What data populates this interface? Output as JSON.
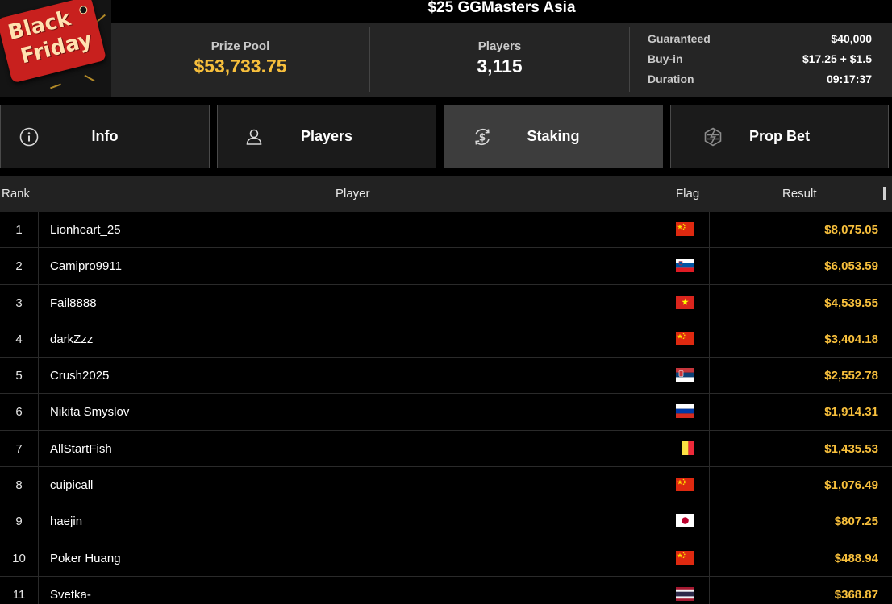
{
  "title": "$25 GGMasters Asia",
  "banner": {
    "line1": "Black",
    "line2": "Friday"
  },
  "stats": {
    "prize_pool_label": "Prize Pool",
    "prize_pool_value": "$53,733.75",
    "players_label": "Players",
    "players_value": "3,115",
    "guaranteed_label": "Guaranteed",
    "guaranteed_value": "$40,000",
    "buyin_label": "Buy-in",
    "buyin_value": "$17.25 + $1.5",
    "duration_label": "Duration",
    "duration_value": "09:17:37"
  },
  "tabs": [
    {
      "label": "Info",
      "icon": "info-icon",
      "active": false
    },
    {
      "label": "Players",
      "icon": "user-icon",
      "active": false
    },
    {
      "label": "Staking",
      "icon": "dollar-cycle-icon",
      "active": true
    },
    {
      "label": "Prop Bet",
      "icon": "prop-bet-icon",
      "active": false
    }
  ],
  "table": {
    "headers": {
      "rank": "Rank",
      "player": "Player",
      "flag": "Flag",
      "result": "Result"
    },
    "rows": [
      {
        "rank": "1",
        "player": "Lionheart_25",
        "flag": "cn",
        "result": "$8,075.05"
      },
      {
        "rank": "2",
        "player": "Camipro9911",
        "flag": "si",
        "result": "$6,053.59"
      },
      {
        "rank": "3",
        "player": "Fail8888",
        "flag": "vn",
        "result": "$4,539.55"
      },
      {
        "rank": "4",
        "player": "darkZzz",
        "flag": "cn",
        "result": "$3,404.18"
      },
      {
        "rank": "5",
        "player": "Crush2025",
        "flag": "rs",
        "result": "$2,552.78"
      },
      {
        "rank": "6",
        "player": "Nikita Smyslov",
        "flag": "ru",
        "result": "$1,914.31"
      },
      {
        "rank": "7",
        "player": "AllStartFish",
        "flag": "be",
        "result": "$1,435.53"
      },
      {
        "rank": "8",
        "player": "cuipicall",
        "flag": "cn",
        "result": "$1,076.49"
      },
      {
        "rank": "9",
        "player": "haejin",
        "flag": "jp",
        "result": "$807.25"
      },
      {
        "rank": "10",
        "player": "Poker Huang",
        "flag": "cn",
        "result": "$488.94"
      },
      {
        "rank": "11",
        "player": "Svetka-",
        "flag": "th",
        "result": "$368.87"
      }
    ]
  },
  "colors": {
    "accent_gold": "#f7bf3c",
    "panel": "#252525",
    "tab_active": "#3d3d3d"
  }
}
